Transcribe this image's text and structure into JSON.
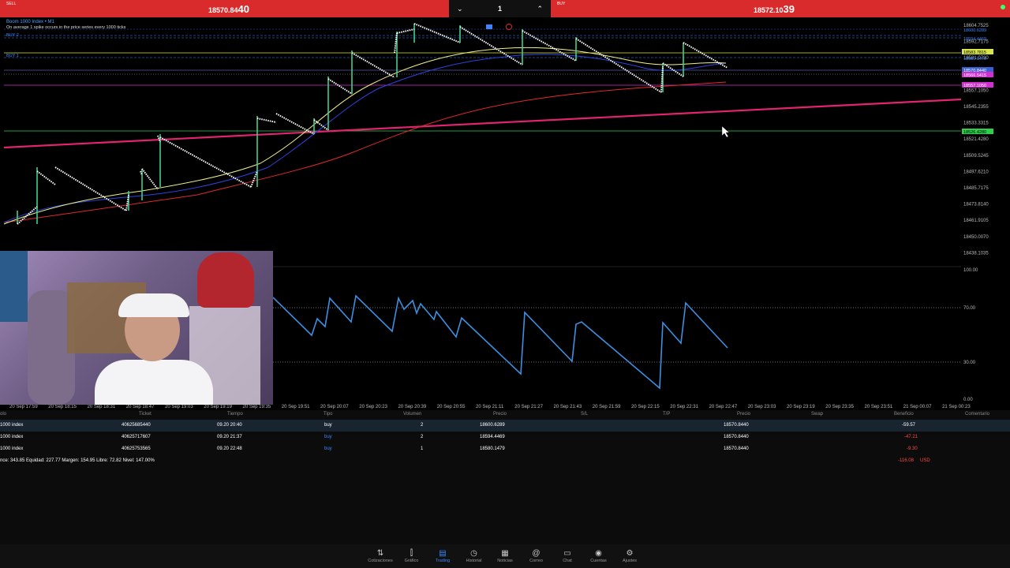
{
  "topbar": {
    "sell_label": "SELL",
    "sell_price_main": "18570.84",
    "sell_price_big": "40",
    "lot_size": "1",
    "buy_label": "BUY",
    "buy_price_main": "18572.10",
    "buy_price_big": "39"
  },
  "chart": {
    "symbol_title": "Boom 1000 Index • M1",
    "description": "On average 1 spike occurs in the price series every 1000 ticks",
    "line_labels": [
      "BUY 2",
      "BUY 1"
    ],
    "price_axis": [
      "18604.7525",
      "18592.7175",
      "18581.0730",
      "18569.0435",
      "18557.1050",
      "18545.2355",
      "18533.3315",
      "18521.4280",
      "18509.5245",
      "18497.6210",
      "18485.7175",
      "18473.8140",
      "18461.9105",
      "18450.0070",
      "18438.1035"
    ],
    "price_tags": [
      "18600.6289",
      "18594.4469",
      "18583.7815",
      "18580.1479",
      "18570.8440",
      "18566.5415",
      "18557.1050",
      "18526.4280"
    ],
    "time_axis": [
      "20 Sep 17:59",
      "20 Sep 18:15",
      "20 Sep 18:31",
      "20 Sep 18:47",
      "20 Sep 19:03",
      "20 Sep 19:19",
      "20 Sep 19:35",
      "20 Sep 19:51",
      "20 Sep 20:07",
      "20 Sep 20:23",
      "20 Sep 20:39",
      "20 Sep 20:55",
      "20 Sep 21:11",
      "20 Sep 21:27",
      "20 Sep 21:43",
      "20 Sep 21:59",
      "20 Sep 22:15",
      "20 Sep 22:31",
      "20 Sep 22:47",
      "20 Sep 23:03",
      "20 Sep 23:19",
      "20 Sep 23:35",
      "20 Sep 23:51",
      "21 Sep 00:07",
      "21 Sep 00:23"
    ],
    "osc_axis": [
      "100.00",
      "70.00",
      "30.00",
      "0.00"
    ]
  },
  "table": {
    "headers": [
      "olo",
      "Ticket",
      "Tiempo",
      "Tipo",
      "Volumen",
      "Precio",
      "S/L",
      "T/P",
      "Precio",
      "Swap",
      "Beneficio",
      "Comentario"
    ],
    "rows": [
      {
        "symbol": "1000 index",
        "ticket": "40625685440",
        "time": "09.20 20:40",
        "type": "buy",
        "volume": "2",
        "price": "18600.6289",
        "current": "18570.8440",
        "profit": "-59.57"
      },
      {
        "symbol": "1000 index",
        "ticket": "40625717607",
        "time": "09.20 21:37",
        "type": "buy",
        "volume": "2",
        "price": "18594.4469",
        "current": "18570.8440",
        "profit": "-47.21"
      },
      {
        "symbol": "1000 index",
        "ticket": "40625753565",
        "time": "09.20 22:48",
        "type": "buy",
        "volume": "1",
        "price": "18580.1479",
        "current": "18570.8440",
        "profit": "-9.30"
      }
    ],
    "summary_text": "nce: 343.85 Equidad: 227.77 Margen: 154.95 Libre: 72.82 Nivel: 147.00%",
    "summary_total": "-116.08",
    "summary_currency": "USD"
  },
  "nav": [
    {
      "label": "Cotizaciones",
      "icon": "quotes-icon",
      "glyph": "⇅"
    },
    {
      "label": "Gráfico",
      "icon": "chart-icon",
      "glyph": "⫿"
    },
    {
      "label": "Trading",
      "icon": "trading-icon",
      "glyph": "▤"
    },
    {
      "label": "Historial",
      "icon": "history-icon",
      "glyph": "◷"
    },
    {
      "label": "Noticias",
      "icon": "news-icon",
      "glyph": "▦"
    },
    {
      "label": "Correo",
      "icon": "mail-icon",
      "glyph": "@"
    },
    {
      "label": "Chat",
      "icon": "chat-icon",
      "glyph": "▭"
    },
    {
      "label": "Cuentas",
      "icon": "accounts-icon",
      "glyph": "◉"
    },
    {
      "label": "Ajustes",
      "icon": "settings-icon",
      "glyph": "⚙"
    }
  ],
  "active_nav": "Trading",
  "colors": {
    "sell_bar": "#d92b2b",
    "buy_bar": "#d92b2b",
    "accent": "#3b86ff",
    "trend_line": "#e0246f",
    "ma_yellow": "#f2f28a",
    "ma_blue": "#2d43e0",
    "ma_red": "#e02a2a",
    "oscillator": "#3d8fe0"
  }
}
